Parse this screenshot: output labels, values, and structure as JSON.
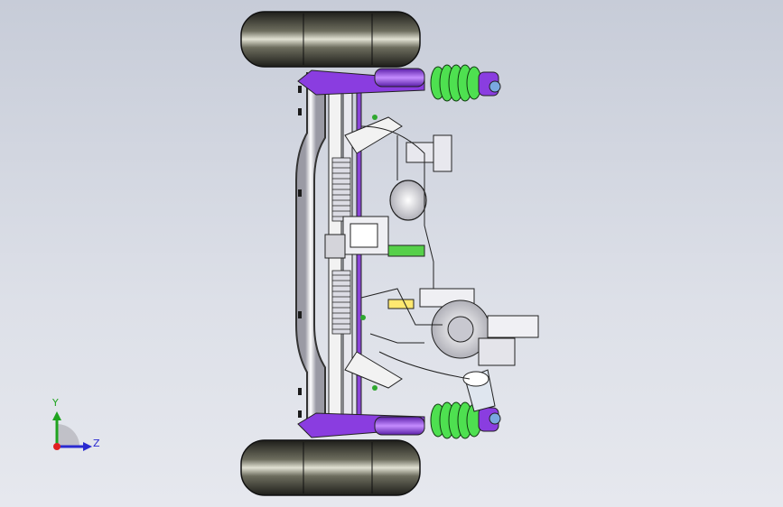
{
  "window": {
    "title": ""
  },
  "model": {
    "name": "",
    "colors": {
      "background_top": "#c7ccd8",
      "background_bottom": "#e6e8ee",
      "tire": "#2c2c26",
      "tire_highlight": "#d8d8c8",
      "spring": "#4ee050",
      "damper": "#7a2ad8",
      "frame": "#f2f2f2",
      "line": "#222222"
    }
  },
  "triad": {
    "y_label": "Y",
    "z_label": "Z",
    "y_color": "#1fa31f",
    "z_color": "#2a2ad0",
    "origin_color": "#e02020"
  }
}
